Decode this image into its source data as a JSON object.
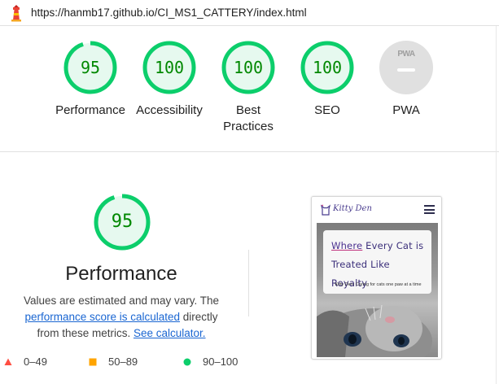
{
  "header": {
    "url": "https://hanmb17.github.io/CI_MS1_CATTERY/index.html"
  },
  "gauges": [
    {
      "label": "Performance",
      "score": "95",
      "fraction": 0.95
    },
    {
      "label": "Accessibility",
      "score": "100",
      "fraction": 1.0
    },
    {
      "label": "Best Practices",
      "score": "100",
      "fraction": 1.0
    },
    {
      "label": "SEO",
      "score": "100",
      "fraction": 1.0
    },
    {
      "label": "PWA",
      "badge_text": "PWA"
    }
  ],
  "performance": {
    "score": "95",
    "fraction": 0.95,
    "title": "Performance",
    "desc_1": "Values are estimated and may vary. The",
    "link_1": "performance score is calculated",
    "desc_2": "directly",
    "desc_3": "from these metrics.",
    "link_2": "See calculator."
  },
  "legend": [
    {
      "range": "0–49",
      "shape": "triangle",
      "color": "#ff4e42"
    },
    {
      "range": "50–89",
      "shape": "square",
      "color": "#ffa400"
    },
    {
      "range": "90–100",
      "shape": "circle",
      "color": "#0cce6b"
    }
  ],
  "screenshot": {
    "brand": "Kitty Den",
    "heading_where": "Where",
    "heading_rest": "Every Cat is Treated Like Royalty",
    "subtitle": "Kitty Den: Caring for cats one paw at a time"
  },
  "colors": {
    "pass": "#0cce6b",
    "pass_text": "#008800",
    "pass_fill": "#e6f9ef",
    "link": "#1a66d2"
  }
}
